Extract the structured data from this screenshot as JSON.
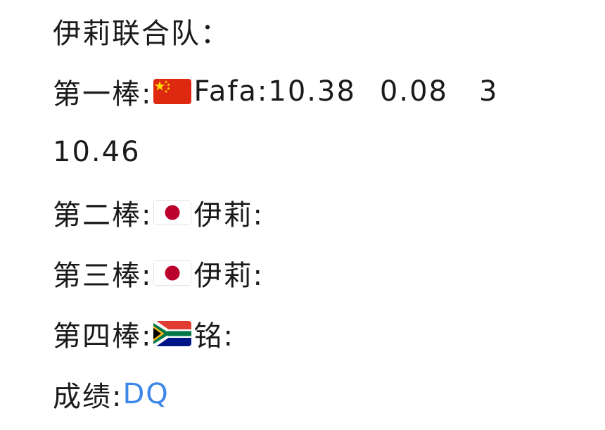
{
  "post": {
    "team_title": "伊莉联合队：",
    "legs": [
      {
        "label": "第一棒:",
        "flag": "china-flag",
        "runner": "Fafa:",
        "time": "10.38",
        "reaction": "0.08",
        "lane": "3",
        "total": "10.46"
      },
      {
        "label": "第二棒:",
        "flag": "japan-flag",
        "runner": "伊莉:"
      },
      {
        "label": "第三棒:",
        "flag": "japan-flag",
        "runner": "伊莉:"
      },
      {
        "label": "第四棒:",
        "flag": "south-africa-flag",
        "runner": "铭:"
      }
    ],
    "result_label": "成绩:",
    "result_value": "DQ"
  },
  "colors": {
    "text": "#1a1a1a",
    "link": "#3d86ea",
    "background": "#ffffff"
  }
}
